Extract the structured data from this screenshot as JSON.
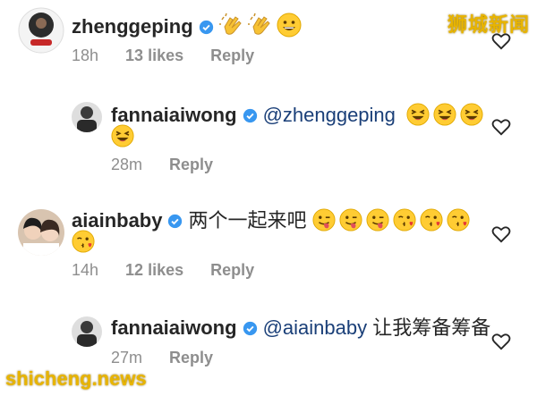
{
  "watermark": {
    "top": "狮城新闻",
    "bottom": "shicheng.news"
  },
  "comments": [
    {
      "username": "zhenggeping",
      "mention": "",
      "text": "",
      "emojis": [
        "clap",
        "clap",
        "grin"
      ],
      "time": "18h",
      "likes": "13 likes",
      "reply": "Reply"
    },
    {
      "username": "fannaiaiwong",
      "mention": "@zhenggeping",
      "text": "",
      "emojis": [
        "laugh",
        "laugh",
        "laugh",
        "laugh"
      ],
      "time": "28m",
      "likes": "",
      "reply": "Reply"
    },
    {
      "username": "aiainbaby",
      "mention": "",
      "text": "两个一起来吧",
      "emojis": [
        "tongue",
        "tongue",
        "tongue",
        "kiss",
        "kiss",
        "kiss",
        "kiss"
      ],
      "time": "14h",
      "likes": "12 likes",
      "reply": "Reply"
    },
    {
      "username": "fannaiaiwong",
      "mention": "@aiainbaby",
      "text": "让我筹备筹备",
      "emojis": [],
      "time": "27m",
      "likes": "",
      "reply": "Reply"
    }
  ]
}
